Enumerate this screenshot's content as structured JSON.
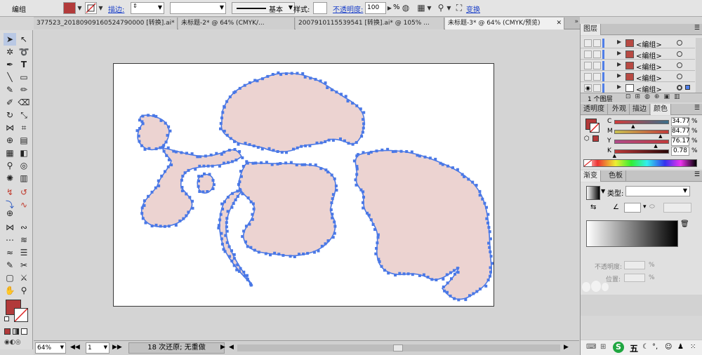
{
  "control_bar": {
    "selection_label": "编组",
    "stroke_label": "描边:",
    "stroke_preset": "基本",
    "style_label": "样式:",
    "opacity_label": "不透明度:",
    "opacity_value": "100",
    "opacity_unit": "%",
    "transform_label": "变换",
    "fill_color": "#b23a3a"
  },
  "doc_tabs": [
    {
      "label": "377523_20180909160524790000 [转换].ai* @..."
    },
    {
      "label": "未标题-2* @ 64% (CMYK/..."
    },
    {
      "label": "2007910115539541 [转换].ai* @ 105% ..."
    },
    {
      "label": "未标题-3* @ 64% (CMYK/预览)"
    }
  ],
  "layers_panel": {
    "title": "图层",
    "rows": [
      {
        "label": "<编组>"
      },
      {
        "label": "<编组>"
      },
      {
        "label": "<编组>"
      },
      {
        "label": "<编组>"
      },
      {
        "label": "<编组>"
      }
    ],
    "footer": "1 个图层"
  },
  "color_panel": {
    "tabs": [
      "透明度",
      "外观",
      "描边",
      "颜色"
    ],
    "active_tab": "颜色",
    "channels": [
      {
        "key": "C",
        "value": "34.77",
        "unit": "%",
        "level": 0.3477
      },
      {
        "key": "M",
        "value": "84.77",
        "unit": "%",
        "level": 0.8477
      },
      {
        "key": "Y",
        "value": "76.17",
        "unit": "%",
        "level": 0.7617
      },
      {
        "key": "K",
        "value": "0.78",
        "unit": "%",
        "level": 0.0078
      }
    ]
  },
  "gradient_panel": {
    "tabs": [
      "渐变",
      "色板"
    ],
    "type_label": "类型:",
    "opacity_label": "不透明度:",
    "position_label": "位置:",
    "unit": "%"
  },
  "status_bar": {
    "zoom": "64%",
    "artboard": "1",
    "message": "18 次还原; 无重做"
  },
  "taskbar": {
    "ime_label": "五"
  },
  "colors": {
    "shape_fill": "#ecd3d1",
    "anchor": "#4a78e6",
    "swatch_red": "#b23a3a"
  }
}
